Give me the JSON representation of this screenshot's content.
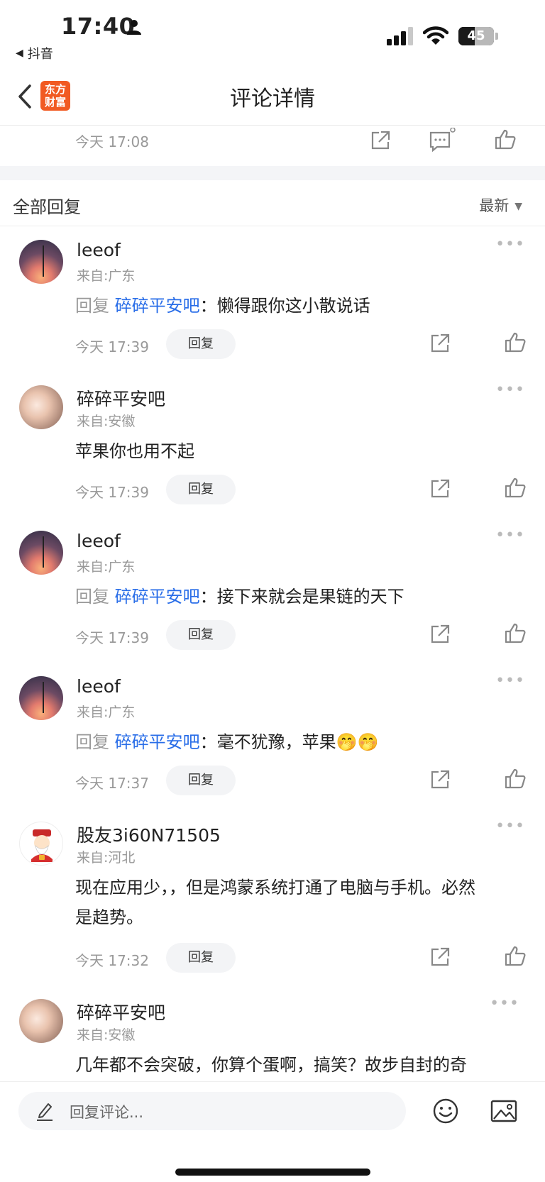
{
  "status_bar": {
    "time": "17:40",
    "back_app": "抖音",
    "battery": "45",
    "battery_level": 0.45
  },
  "nav": {
    "logo_line1": "东方",
    "logo_line2": "财富",
    "title": "评论详情"
  },
  "parent": {
    "time": "今天 17:08"
  },
  "section": {
    "label": "全部回复",
    "sort": "最新"
  },
  "comments": [
    {
      "name": "leeof",
      "from": "来自:广东",
      "reply_prefix": "回复",
      "reply_to": "碎碎平安吧",
      "sep": "：",
      "text": "懒得跟你这小散说话",
      "time": "今天 17:39",
      "reply_label": "回复"
    },
    {
      "name": "碎碎平安吧",
      "from": "来自:安徽",
      "text": "苹果你也用不起",
      "time": "今天 17:39",
      "reply_label": "回复"
    },
    {
      "name": "leeof",
      "from": "来自:广东",
      "reply_prefix": "回复",
      "reply_to": "碎碎平安吧",
      "sep": "：",
      "text": "接下来就会是果链的天下",
      "time": "今天 17:39",
      "reply_label": "回复"
    },
    {
      "name": "leeof",
      "from": "来自:广东",
      "reply_prefix": "回复",
      "reply_to": "碎碎平安吧",
      "sep": "：",
      "text": "毫不犹豫，苹果🤭🤭",
      "time": "今天 17:37",
      "reply_label": "回复"
    },
    {
      "name": "股友3i60N71505",
      "from": "来自:河北",
      "text_line1": "现在应用少，，但是鸿蒙系统打通了电脑与手机。必然",
      "text_line2": "是趋势。",
      "time": "今天 17:32",
      "reply_label": "回复"
    },
    {
      "name": "碎碎平安吧",
      "from": "来自:安徽",
      "text": "几年都不会突破，你算个蛋啊，搞笑？故步自封的奇"
    }
  ],
  "bottom": {
    "placeholder": "回复评论..."
  }
}
